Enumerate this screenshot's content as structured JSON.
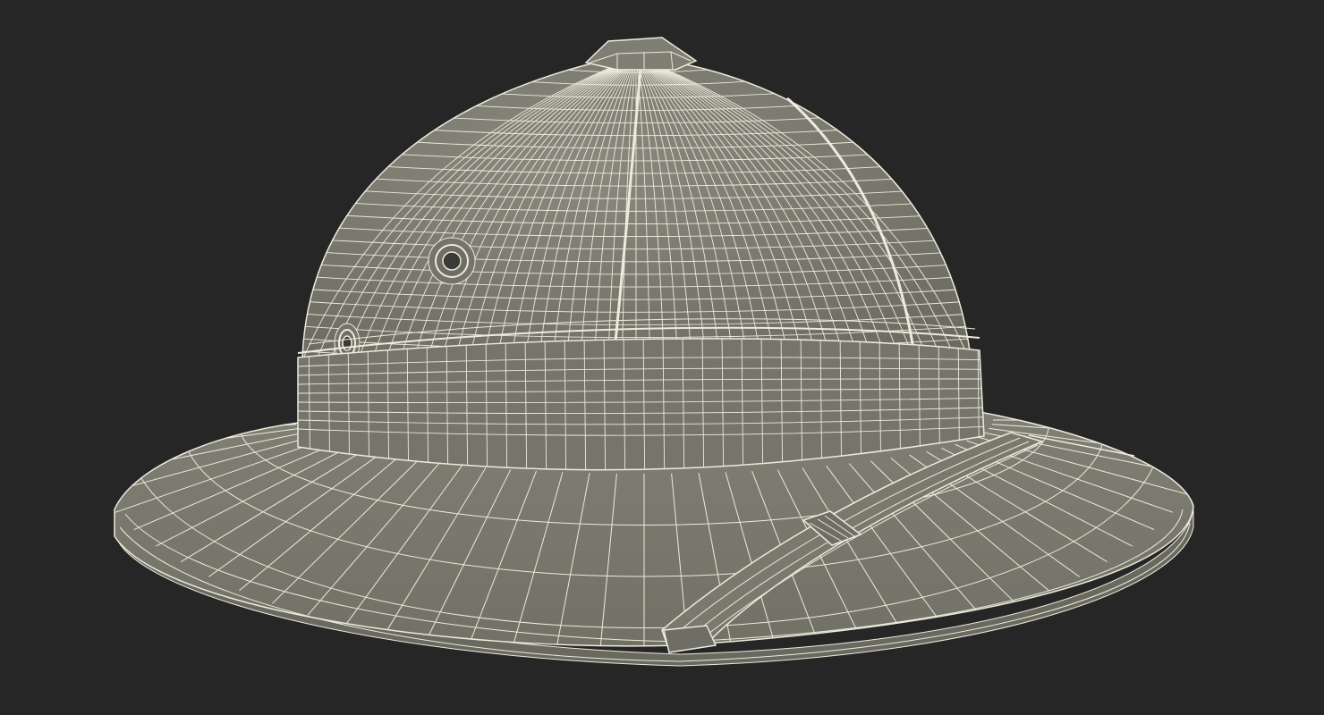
{
  "scene": {
    "subject_icon": "pith-helmet-wireframe-icon",
    "colors": {
      "background": "#262626",
      "surface": "#7b7a6f",
      "surface_dark": "#6b6a60",
      "surface_light": "#8a897e",
      "wire": "#ecebdc"
    },
    "render_style": "wireframe-on-shaded"
  }
}
